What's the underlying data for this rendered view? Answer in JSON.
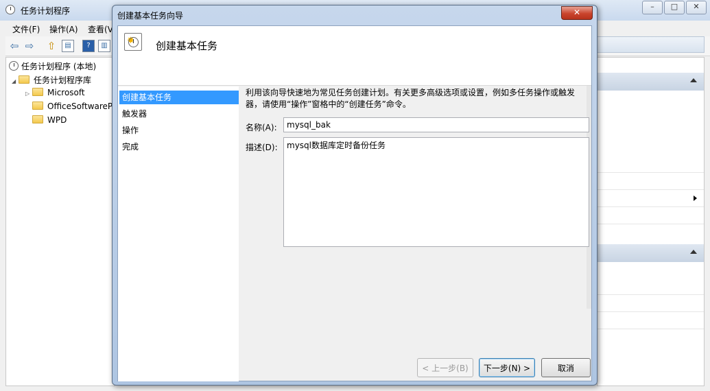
{
  "main_window": {
    "title": "任务计划程序",
    "menu": [
      "文件(F)",
      "操作(A)",
      "查看(V"
    ],
    "window_buttons": [
      "–",
      "□",
      "✕"
    ],
    "tree": {
      "root": "任务计划程序 (本地)",
      "library": "任务计划程序库",
      "children": [
        "Microsoft",
        "OfficeSoftwareP",
        "WPD"
      ]
    }
  },
  "dialog": {
    "title": "创建基本任务向导",
    "close_label": "✕",
    "header_title": "创建基本任务",
    "steps": [
      "创建基本任务",
      "触发器",
      "操作",
      "完成"
    ],
    "selected_step": 0,
    "description": "利用该向导快速地为常见任务创建计划。有关更多高级选项或设置，例如多任务操作或触发器，请使用“操作”窗格中的“创建任务”命令。",
    "name_label": "名称(A):",
    "name_value": "mysql_bak",
    "desc_label": "描述(D):",
    "desc_value": "mysql数据库定时备份任务",
    "buttons": {
      "back": "< 上一步(B)",
      "next": "下一步(N) >",
      "cancel": "取消"
    }
  },
  "colors": {
    "selection": "#3399ff",
    "close_button": "#c9442c"
  }
}
